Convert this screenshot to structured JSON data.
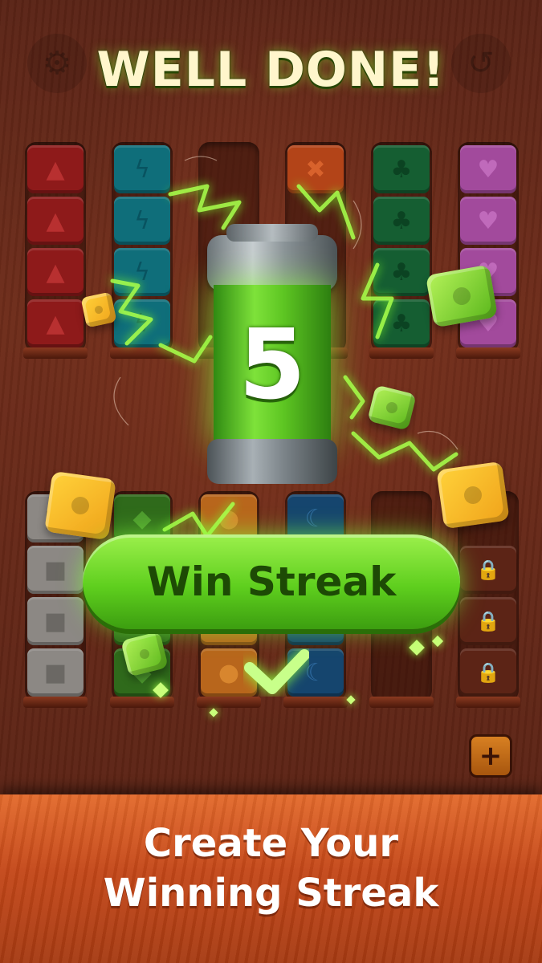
{
  "title": "WELL DONE!",
  "top_bar": {
    "settings_icon": "gear-icon",
    "undo_icon": "undo-icon"
  },
  "columns_top": [
    {
      "color": "red",
      "icon": "triangle",
      "glyph": "▲",
      "count": 4
    },
    {
      "color": "teal",
      "icon": "lightning",
      "glyph": "ϟ",
      "count": 4
    },
    {
      "color": "empty",
      "icon": "",
      "glyph": "",
      "count": 0
    },
    {
      "color": "orange",
      "icon": "cross",
      "glyph": "✖",
      "count": 1
    },
    {
      "color": "green",
      "icon": "club",
      "glyph": "♣",
      "count": 4
    },
    {
      "color": "purple",
      "icon": "heart",
      "glyph": "♥",
      "count": 4
    }
  ],
  "columns_bottom": [
    {
      "color": "grey",
      "icon": "square",
      "glyph": "■",
      "count": 4
    },
    {
      "color": "lime",
      "icon": "diamond",
      "glyph": "◆",
      "count": 4
    },
    {
      "color": "amber",
      "icon": "circle",
      "glyph": "●",
      "count": 4
    },
    {
      "color": "blue",
      "icon": "moon",
      "glyph": "☾",
      "count": 4
    },
    {
      "color": "empty",
      "icon": "",
      "glyph": "",
      "count": 0
    },
    {
      "color": "locked",
      "icon": "lock",
      "glyph": "🔒",
      "count": 3
    }
  ],
  "battery": {
    "streak_value": "5",
    "color": "#6fdc2c"
  },
  "win_button": {
    "label": "Win Streak"
  },
  "check_icon": "checkmark-icon",
  "add_button": {
    "icon": "plus-icon",
    "glyph": "+"
  },
  "banner": {
    "line1": "Create Your",
    "line2": "Winning Streak"
  },
  "colors": {
    "accent_green": "#6fdc2c",
    "banner_orange": "#d2541f",
    "board_wood": "#5e2516"
  }
}
